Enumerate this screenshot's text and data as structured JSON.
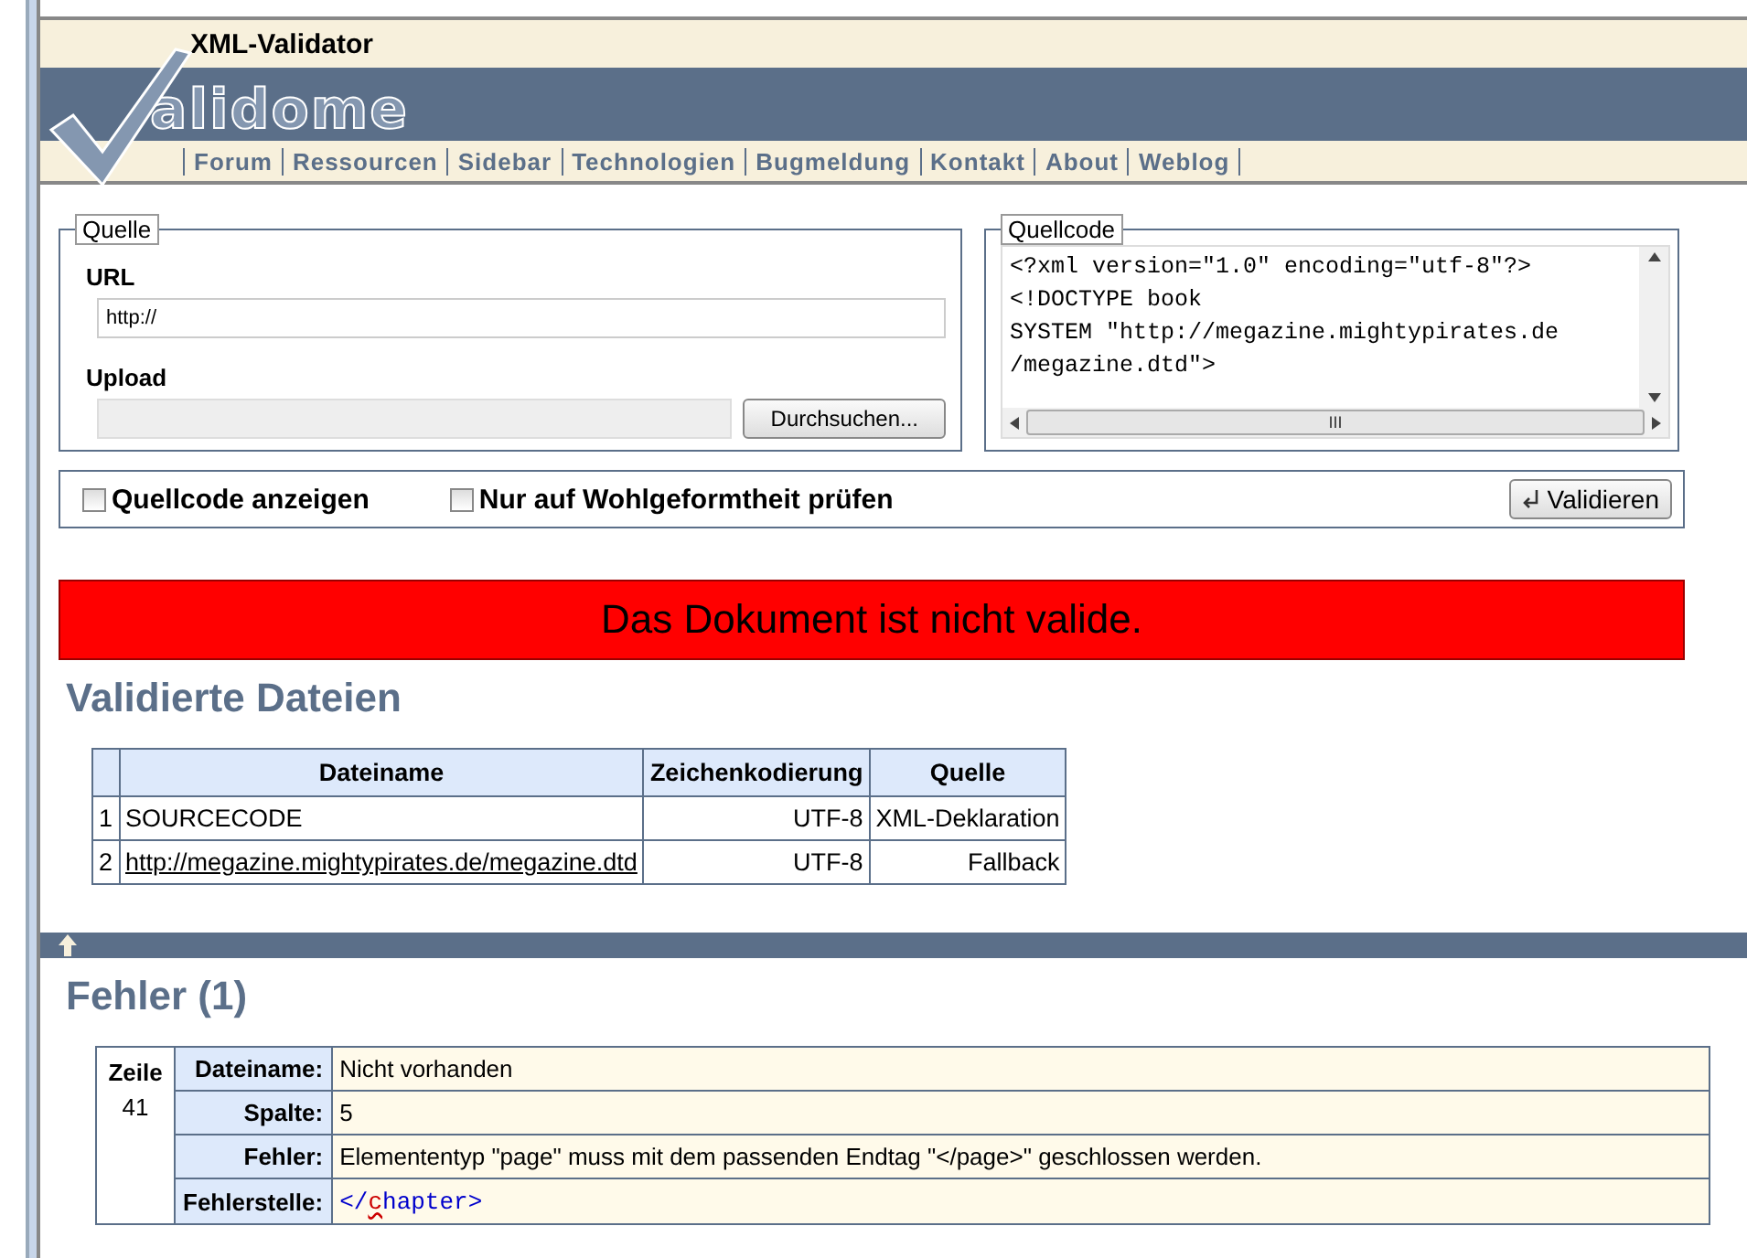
{
  "header": {
    "title": "XML-Validator",
    "logo_text": "alidome",
    "nav": [
      "Forum",
      "Ressourcen",
      "Sidebar",
      "Technologien",
      "Bugmeldung",
      "Kontakt",
      "About",
      "Weblog"
    ]
  },
  "source": {
    "legend": "Quelle",
    "url_label": "URL",
    "url_value": "http://",
    "upload_label": "Upload",
    "browse_button": "Durchsuchen..."
  },
  "sourcecode": {
    "legend": "Quellcode",
    "lines": [
      "<?xml version=\"1.0\" encoding=\"utf-8\"?>",
      "<!DOCTYPE book",
      "SYSTEM \"http://megazine.mightypirates.de",
      "/megazine.dtd\">"
    ],
    "scroll_grip": "III"
  },
  "options": [
    {
      "label": "Quellcode anzeigen",
      "checked": false
    },
    {
      "label": "Nur auf Wohlgeformtheit prüfen",
      "checked": false
    }
  ],
  "validate_button": "Validieren",
  "result": {
    "message": "Das Dokument ist nicht valide.",
    "valid": false
  },
  "files": {
    "heading": "Validierte Dateien",
    "columns": [
      "Dateiname",
      "Zeichenkodierung",
      "Quelle"
    ],
    "rows": [
      {
        "index": "1",
        "name": "SOURCECODE",
        "link": false,
        "encoding": "UTF-8",
        "source": "XML-Deklaration"
      },
      {
        "index": "2",
        "name": "http://megazine.mightypirates.de/megazine.dtd",
        "link": true,
        "encoding": "UTF-8",
        "source": "Fallback"
      }
    ]
  },
  "errors": {
    "heading": "Fehler (1)",
    "line_label": "Zeile",
    "line_value": "41",
    "fields": [
      {
        "label": "Dateiname:",
        "value": "Nicht vorhanden"
      },
      {
        "label": "Spalte:",
        "value": "5"
      },
      {
        "label": "Fehler:",
        "value": "Elemententyp \"page\" muss mit dem passenden Endtag \"</page>\" geschlossen werden."
      }
    ],
    "position_label": "Fehlerstelle:",
    "position": {
      "before": "</",
      "marked": "c",
      "after": "hapter>"
    }
  }
}
